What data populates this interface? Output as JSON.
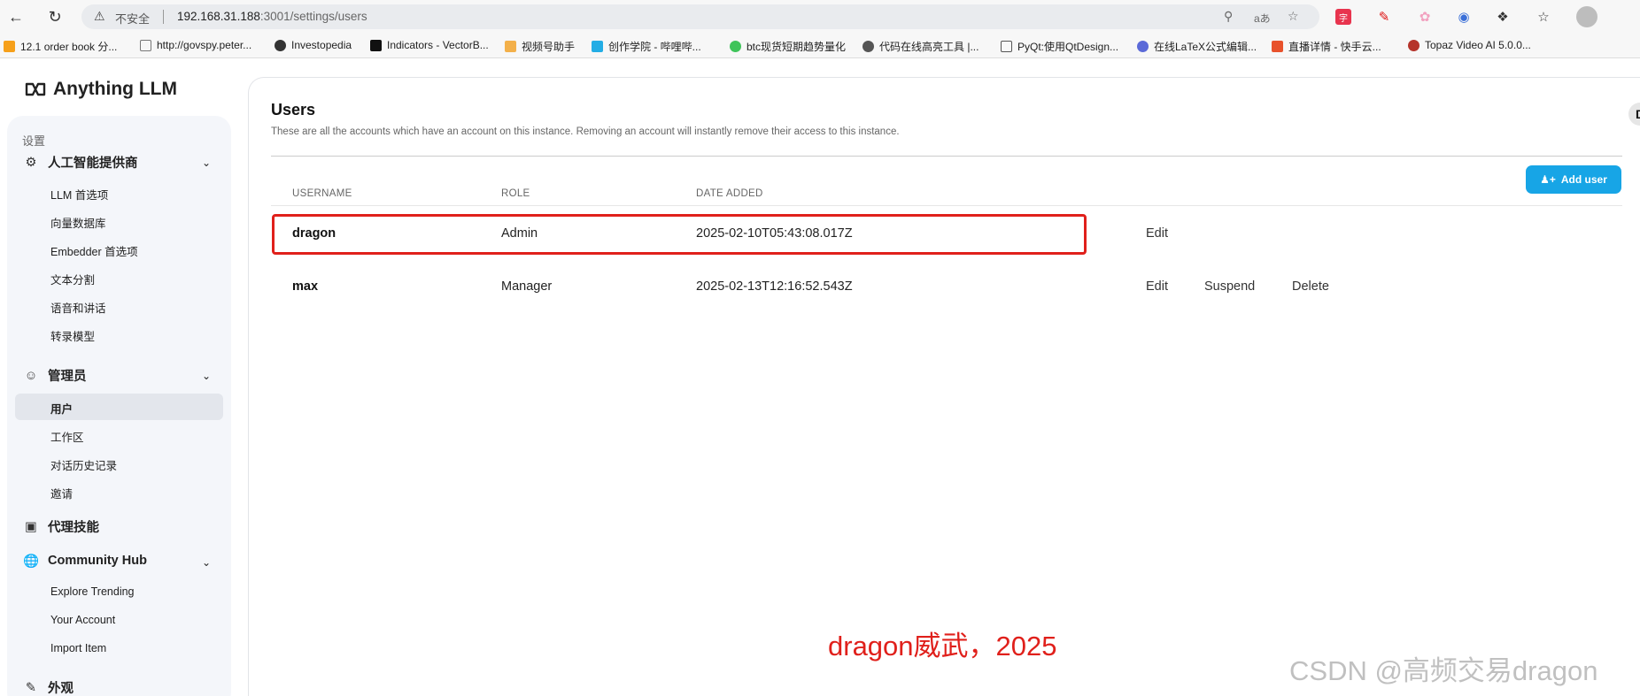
{
  "browser": {
    "insecure_label": "不安全",
    "url_host": "192.168.31.188",
    "url_rest": ":3001/settings/users",
    "bookmarks": [
      "12.1 order book 分...",
      "http://govspy.peter...",
      "Investopedia",
      "Indicators - VectorB...",
      "视频号助手",
      "创作学院 - 哔哩哔...",
      "btc现货短期趋势量化",
      "代码在线高亮工具 |...",
      "PyQt:使用QtDesign...",
      "在线LaTeX公式编辑...",
      "直播详情 - 快手云...",
      "Topaz Video AI 5.0.0..."
    ]
  },
  "brand": {
    "name": "Anything LLM"
  },
  "sidebar": {
    "section_label": "设置",
    "groups": [
      {
        "label": "人工智能提供商",
        "items": [
          "LLM 首选项",
          "向量数据库",
          "Embedder 首选项",
          "文本分割",
          "语音和讲话",
          "转录模型"
        ]
      },
      {
        "label": "管理员",
        "items": [
          "用户",
          "工作区",
          "对话历史记录",
          "邀请"
        ]
      },
      {
        "label": "代理技能",
        "items": []
      },
      {
        "label": "Community Hub",
        "items": [
          "Explore Trending",
          "Your Account",
          "Import Item"
        ]
      },
      {
        "label": "外观",
        "items": []
      }
    ]
  },
  "main": {
    "title": "Users",
    "description": "These are all the accounts which have an account on this instance. Removing an account will instantly remove their access to this instance.",
    "add_user_label": "Add user",
    "columns": [
      "USERNAME",
      "ROLE",
      "DATE ADDED"
    ],
    "rows": [
      {
        "username": "dragon",
        "role": "Admin",
        "date": "2025-02-10T05:43:08.017Z",
        "actions": [
          "Edit"
        ]
      },
      {
        "username": "max",
        "role": "Manager",
        "date": "2025-02-13T12:16:52.543Z",
        "actions": [
          "Edit",
          "Suspend",
          "Delete"
        ]
      }
    ],
    "corner_letter": "D"
  },
  "overlay": {
    "caption": "dragon威武，2025",
    "watermark": "CSDN @高频交易dragon"
  },
  "colors": {
    "accent": "#17a5e6",
    "highlight": "#e0201b"
  }
}
